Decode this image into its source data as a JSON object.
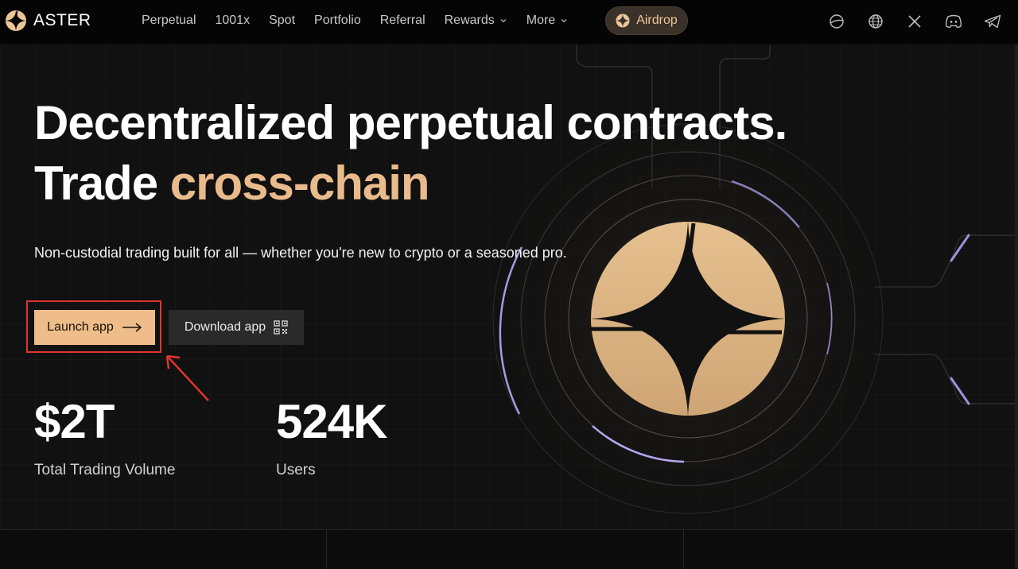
{
  "brand": {
    "name": "ASTER",
    "accent_color": "#e9bb8c"
  },
  "nav": {
    "items": [
      {
        "label": "Perpetual",
        "dropdown": false
      },
      {
        "label": "1001x",
        "dropdown": false
      },
      {
        "label": "Spot",
        "dropdown": false
      },
      {
        "label": "Portfolio",
        "dropdown": false
      },
      {
        "label": "Referral",
        "dropdown": false
      },
      {
        "label": "Rewards",
        "dropdown": true
      },
      {
        "label": "More",
        "dropdown": true
      }
    ],
    "airdrop_label": "Airdrop",
    "right_icons": [
      "theme-icon",
      "globe-icon",
      "x-icon",
      "discord-icon",
      "telegram-icon"
    ]
  },
  "hero": {
    "headline_line1": "Decentralized perpetual contracts.",
    "headline_line2_prefix": "Trade ",
    "headline_line2_accent": "cross-chain",
    "subtext": "Non-custodial trading built for all — whether you're new to crypto or a seasoned pro.",
    "launch_label": "Launch app",
    "download_label": "Download app"
  },
  "stats": [
    {
      "value": "$2T",
      "label": "Total Trading Volume"
    },
    {
      "value": "524K",
      "label": "Users"
    }
  ]
}
